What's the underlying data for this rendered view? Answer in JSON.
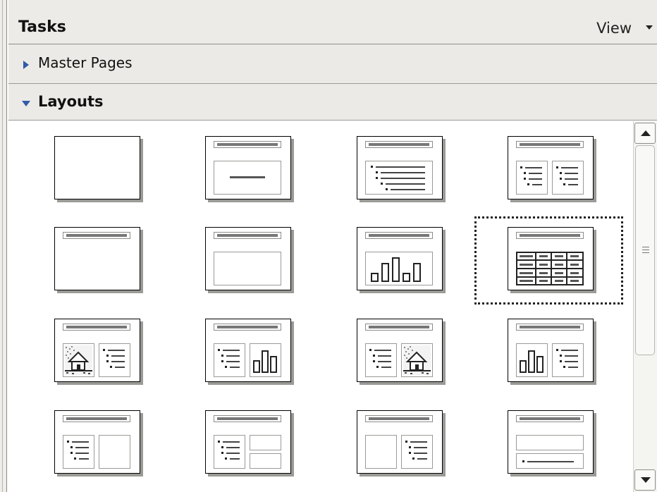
{
  "panel": {
    "title": "Tasks",
    "view_label": "View"
  },
  "sections": {
    "master_pages_label": "Master Pages",
    "layouts_label": "Layouts"
  },
  "layouts": [
    "Blank Slide",
    "Title Slide",
    "Title, Content",
    "Title and 2 Content",
    "Title Only",
    "Centered Text",
    "Title, Chart",
    "Title, Table",
    "Title, Clipart and Content",
    "Title, Content and Chart",
    "Title, Content and Clipart",
    "Title, Chart and Content",
    "Title, Content and 2 Content",
    "Title, Content over Content",
    "Title, 2 Content and Content",
    "Title, Content over Content (text)"
  ],
  "selected_layout": "Title, Table",
  "icons": {
    "master_pages": "triangle-right-icon",
    "layouts": "triangle-down-icon",
    "view_menu": "chevron-down-icon",
    "scroll_up": "scroll-up-icon",
    "scroll_down": "scroll-down-icon"
  },
  "colors": {
    "header_bg": "#ebeae6",
    "triangle_blue": "#2f5ba8",
    "selection_border": "#222222"
  }
}
